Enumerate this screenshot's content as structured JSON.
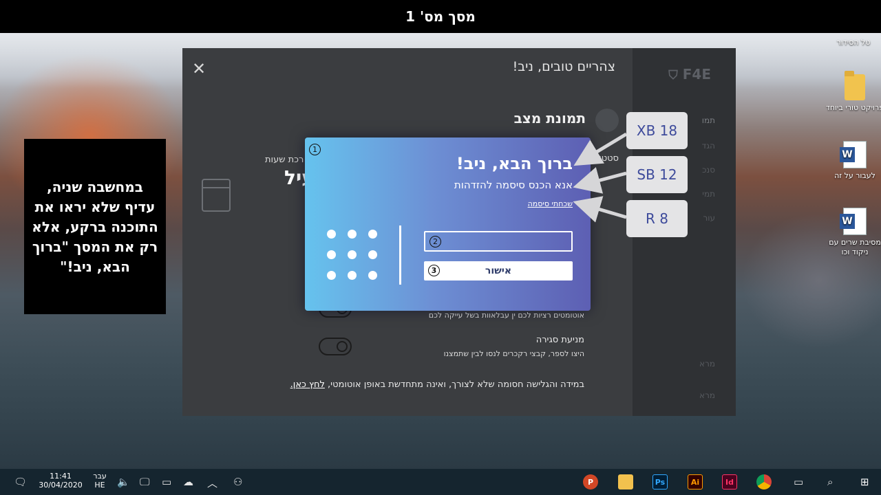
{
  "slide": {
    "title": "מסך מס' 1"
  },
  "desktop": {
    "icons": [
      {
        "label": "טל הסידור"
      },
      {
        "label": "פרויקט טורי ביוחד"
      },
      {
        "label": "לעבור על זה"
      },
      {
        "label": "מסיבת שרים עם ניקוד וכו"
      }
    ]
  },
  "app": {
    "logo": "F4E",
    "greeting": "צהריים טובים, ניב!",
    "section_title": "תמונת מצב",
    "stats_label": "סטטו",
    "hours_label": "רכת שעות",
    "big_value": "עיל",
    "sidebar_items": [
      "תמו",
      "הגד",
      "סנכ",
      "תמי",
      "עור",
      "מרא",
      "מרא"
    ],
    "options": [
      {
        "title": "",
        "desc": "אוטומטים רציות לכם ין עבלאוות בשל עייקה לכם"
      },
      {
        "title": "מניעת סגירה",
        "desc": "היצו לספר, קבצי רקכרים לנסו לבין שתמצנו"
      }
    ],
    "footer_text": "במידה והגלישה חסומה שלא לצורך, ואינה מתחדשת באופן אוטומטי, ",
    "footer_link": "לחץ כאן."
  },
  "login": {
    "title": "ברוך הבא, ניב!",
    "subtitle": "אנא הכנס סיסמה להזדהות",
    "forgot": "שכחתי סיסמה",
    "password_placeholder": "",
    "submit": "אישור",
    "markers": [
      "1",
      "2",
      "3"
    ]
  },
  "annotations": [
    "XB 18",
    "SB 12",
    "R 8"
  ],
  "note": "במחשבה שניה, עדיף שלא יראו את התוכנה ברקע, אלא רק את המסך \"ברוך הבא, ניב!\"",
  "taskbar": {
    "time": "11:41",
    "date": "30/04/2020",
    "lang_top": "עבר",
    "lang_bottom": "HE",
    "apps": [
      "P",
      "",
      "Ps",
      "Ai",
      "Id"
    ]
  },
  "colors": {
    "dialog_start": "#66c3ee",
    "dialog_end": "#5d5fb3",
    "annotation_text": "#3d4a9b"
  }
}
